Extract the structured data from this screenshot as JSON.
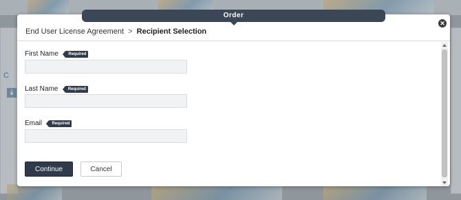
{
  "background": {
    "link_text": "C",
    "download_glyph": "⤓"
  },
  "modal": {
    "title": "Order",
    "close_glyph": "✕",
    "breadcrumb": {
      "previous": "End User License Agreement",
      "separator": ">",
      "current": "Recipient Selection"
    },
    "fields": [
      {
        "label": "First Name",
        "badge": "Required",
        "value": "",
        "placeholder": ""
      },
      {
        "label": "Last Name",
        "badge": "Required",
        "value": "",
        "placeholder": ""
      },
      {
        "label": "Email",
        "badge": "Required",
        "value": "",
        "placeholder": ""
      }
    ],
    "buttons": {
      "continue_label": "Continue",
      "cancel_label": "Cancel"
    }
  },
  "colors": {
    "titlebar": "#3b4656",
    "primary_button": "#2f3b4c",
    "required_badge": "#2f3a4a",
    "input_bg": "#f1f2f3"
  }
}
